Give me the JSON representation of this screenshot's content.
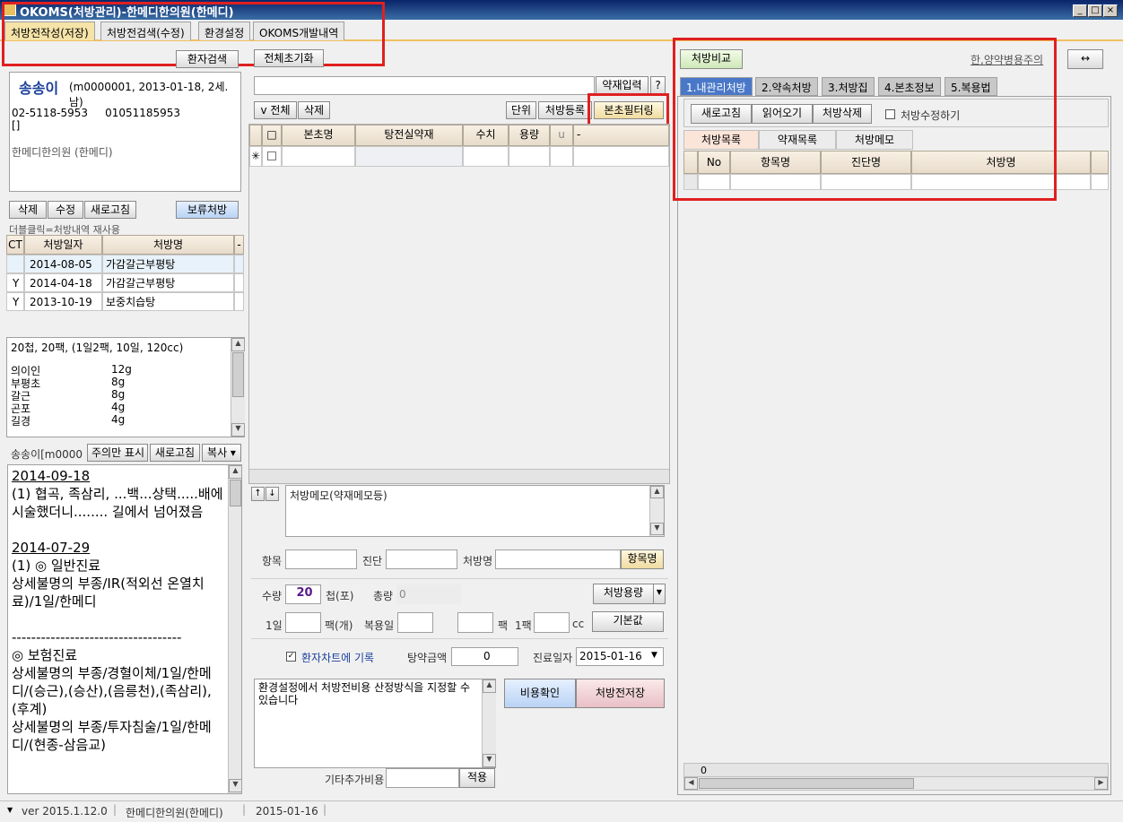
{
  "window": {
    "title": "OKOMS(처방관리)-한메디한의원(한메디)"
  },
  "menu_tabs": [
    {
      "label": "처방전작성(저장)",
      "active": true
    },
    {
      "label": "처방전검색(수정)"
    },
    {
      "label": "환경설정"
    },
    {
      "label": "OKOMS개발내역"
    }
  ],
  "left": {
    "patient_search": "환자검색",
    "patient": {
      "name": "송송이",
      "info": "(m0000001, 2013-01-18, 2세. 남)",
      "phones": "02-5118-5953     01051185953",
      "bracket": "[]",
      "clinic": "한메디한의원 (한메디)"
    },
    "actions": {
      "delete": "삭제",
      "edit": "수정",
      "refresh": "새로고침",
      "hold": "보류처방"
    },
    "hint": "더블클릭=처방내역 재사용",
    "history_headers": [
      "CT",
      "처방일자",
      "처방명",
      "-"
    ],
    "history_rows": [
      {
        "ct": "",
        "date": "2014-08-05",
        "name": "가감갈근부평탕"
      },
      {
        "ct": "Y",
        "date": "2014-04-18",
        "name": "가감갈근부평탕"
      },
      {
        "ct": "Y",
        "date": "2013-10-19",
        "name": "보중치습탕"
      }
    ],
    "recipe_summary": "20첩, 20팩, (1일2팩, 10일, 120cc)",
    "herbs": [
      {
        "name": "의이인",
        "amount": "12g"
      },
      {
        "name": "부평초",
        "amount": "8g"
      },
      {
        "name": "갈근",
        "amount": "8g"
      },
      {
        "name": "곤포",
        "amount": "4g"
      },
      {
        "name": "길경",
        "amount": "4g"
      }
    ],
    "memo_bar": {
      "label": "송송이[m0000",
      "notice_only": "주의만 표시",
      "refresh": "새로고침",
      "copy": "복사 ▾"
    },
    "memo": {
      "d1": "2014-09-18",
      "l1": "(1) 협곡, 족삼리, ...백...상택.....배에 시술했더니........ 길에서 넘어졌음",
      "d2": "2014-07-29",
      "l2": "(1) ◎ 일반진료",
      "l3": " 상세불명의 부종/IR(적외선 온열치료)/1일/한메디",
      "l4": "-----------------------------------",
      "l5": "◎ 보험진료",
      "l6": " 상세불명의 부종/경혈이체/1일/한메디/(승근),(승산),(음릉천),(족삼리),(후계)",
      "l7": " 상세불명의 부종/투자침술/1일/한메디/(현종-삼음교)"
    }
  },
  "middle": {
    "reset_all": "전체초기화",
    "herb_input": "약재입력",
    "help": "?",
    "select_all": "v 전체",
    "delete": "삭제",
    "unit": "단위",
    "register": "처방등록",
    "filter": "본초필터링",
    "grid_headers": [
      "",
      "□",
      "본초명",
      "탕전실약재",
      "수치",
      "용량",
      "u",
      "-"
    ],
    "memo_placeholder": "처방메모(약재메모등)",
    "item_label": "항목",
    "diag_label": "진단",
    "rx_label": "처방명",
    "item_list": "항목명",
    "qty_label": "수량",
    "qty_value": "20",
    "qty_unit": "첩(포)",
    "total_label": "총량",
    "total_value": "0",
    "rx_dose": "처방용량",
    "per_day_label": "1일",
    "pack_unit": "팩(개)",
    "days_label": "복용일",
    "pack_label": "팩",
    "one_pack": "1팩",
    "cc": "cc",
    "default": "기본값",
    "record_chart": "환자차트에 기록",
    "fee_label": "탕약금액",
    "fee_value": "0",
    "date_label": "진료일자",
    "date_value": "2015-01-16",
    "note": "환경설정에서 처방전비용 산정방식을 지정할 수 있습니다",
    "cost_check": "비용확인",
    "save_rx": "처방전저장",
    "extra_cost": "기타추가비용",
    "apply": "적용"
  },
  "right": {
    "compare": "처방비교",
    "caution_link": "한,양약병용주의",
    "swap": "↔",
    "tabs": [
      "1.내관리처방",
      "2.약속처방",
      "3.처방집",
      "4.본초정보",
      "5.복용법"
    ],
    "refresh": "새로고침",
    "load": "읽어오기",
    "delete_rx": "처방삭제",
    "edit_rx": "처방수정하기",
    "subtabs": [
      "처방목록",
      "약재목록",
      "처방메모"
    ],
    "grid_headers": [
      "No",
      "항목명",
      "진단명",
      "처방명"
    ],
    "footer_count": "0"
  },
  "status": {
    "version": "ver 2015.1.12.0",
    "clinic": "한메디한의원(한메디)",
    "date": "2015-01-16"
  }
}
